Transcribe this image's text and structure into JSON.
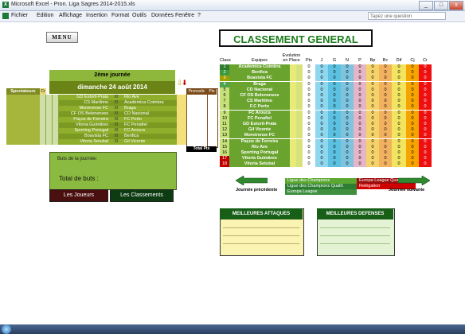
{
  "window": {
    "title": "Microsoft Excel - Pron. Liga Sagres 2014-2015.xls",
    "app_icon": "excel-icon",
    "buttons": [
      "_",
      "□",
      "x"
    ]
  },
  "menu": {
    "items": [
      "Fichier",
      "Edition",
      "Affichage",
      "Insertion",
      "Format",
      "Outils",
      "Données",
      "Fenêtre",
      "?"
    ],
    "help_placeholder": "Tapez une question"
  },
  "menu_button": "MENU",
  "round": {
    "title": "2ème journée",
    "date": "dimanche 24 août 2014",
    "spectators_label": "Spectateurs",
    "cr_label": "Cr",
    "pron_label": "Pronostic",
    "pts_label": "Pts",
    "total_pts_label": "Total Pts",
    "matches": [
      {
        "home": "GD Estoril-Praia",
        "score": "/0",
        "away": "Rio Ave"
      },
      {
        "home": "CS Marítimo",
        "score": "/0",
        "away": "Academica Coimbra"
      },
      {
        "home": "Moreirense FC",
        "score": "/0",
        "away": "Braga"
      },
      {
        "home": "CF OS Belenenses",
        "score": "/0",
        "away": "CD Nacional"
      },
      {
        "home": "Paços de Ferreira",
        "score": "/0",
        "away": "FC Porto"
      },
      {
        "home": "Vitoria Guimãres",
        "score": "/0",
        "away": "FC Penafiel"
      },
      {
        "home": "Sporting Portugal",
        "score": "/0",
        "away": "FC Arouca"
      },
      {
        "home": "Boavista FC",
        "score": "/0",
        "away": "Benfica"
      },
      {
        "home": "Vitoria Setubal",
        "score": "/0",
        "away": "Gil Vicente"
      }
    ]
  },
  "goals": {
    "label": "Buts de la journée:",
    "total_label": "Total de buts :"
  },
  "nav_buttons": {
    "jeux": "Les Joueurs",
    "classements": "Les Classements"
  },
  "classement": {
    "title": "CLASSEMENT GENERAL",
    "headers": {
      "evol": "Evolution en Place",
      "cls": "Class",
      "team": "Equipes",
      "pts": "Pts",
      "j": "J",
      "g": "G",
      "n": "N",
      "p": "P",
      "bp": "Bp",
      "bc": "Bc",
      "dif": "Dif",
      "cj": "Cj",
      "cr": "Cr"
    },
    "rows": [
      {
        "pos": "1",
        "team": "Academica Coimbra"
      },
      {
        "pos": "2",
        "team": "Benfica"
      },
      {
        "pos": "3",
        "team": "Boavista FC"
      },
      {
        "pos": "4",
        "team": "Braga"
      },
      {
        "pos": "5",
        "team": "CD Nacional"
      },
      {
        "pos": "6",
        "team": "CF OS Belenenses"
      },
      {
        "pos": "7",
        "team": "CS Marítimo"
      },
      {
        "pos": "8",
        "team": "F.C Porto"
      },
      {
        "pos": "9",
        "team": "FC Arouca"
      },
      {
        "pos": "10",
        "team": "FC Penafiel"
      },
      {
        "pos": "11",
        "team": "GD Estoril-Praia"
      },
      {
        "pos": "12",
        "team": "Gil Vicente"
      },
      {
        "pos": "13",
        "team": "Moreirense FC"
      },
      {
        "pos": "14",
        "team": "Paços de Ferreira"
      },
      {
        "pos": "15",
        "team": "Rio Ave"
      },
      {
        "pos": "16",
        "team": "Sporting Portugal"
      },
      {
        "pos": "17",
        "team": "Vitoria Guimãres"
      },
      {
        "pos": "18",
        "team": "Vitoria Setubal"
      }
    ],
    "zero": "0",
    "legend": {
      "champions": "Ligue des Champions",
      "champions_qualif": "Ligue des Champions Qualif.",
      "europa": "Europa League",
      "europa_qualif": "Europa League Qualif.",
      "relegation": "Relégation"
    },
    "prev_label": "Journée précédente",
    "next_label": "Journée suivante",
    "colors": {
      "team_bg": "#6aa32d",
      "relegation": "#c00000",
      "champions_q": "#2e7d32"
    }
  },
  "best": {
    "attack_title": "MEILLEURES ATTAQUES",
    "defense_title": "MEILLEURES DEFENSES"
  }
}
